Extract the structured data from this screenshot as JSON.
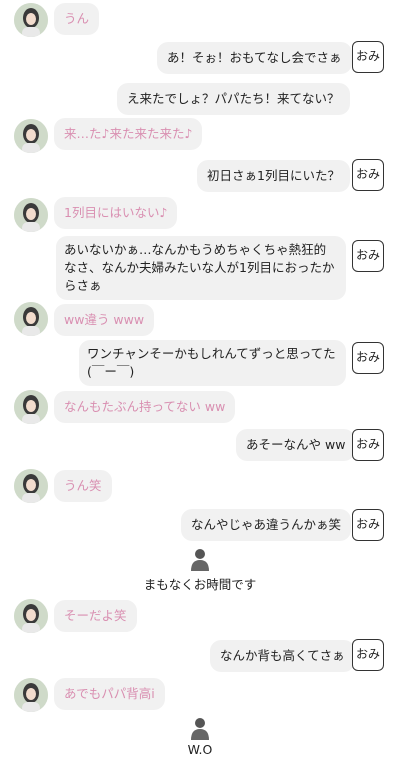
{
  "colors": {
    "incoming_text": "#d98fb1",
    "bubble_bg": "#f1f1f1",
    "outgoing_text": "#222222"
  },
  "badge_label": "おみ",
  "messages": [
    {
      "text": "うん"
    },
    {
      "text": "あ！そぉ！おもてなし会でさぁ"
    },
    {
      "text": "え来たでしょ？パパたち！来てない？"
    },
    {
      "text": "来…た♪来た来た来た♪"
    },
    {
      "text": "初日さぁ1列目にいた？"
    },
    {
      "text": "1列目にはいない♪"
    },
    {
      "text": "あいないかぁ…なんかもうめちゃくちゃ熱狂的なさ、なんか夫婦みたいな人が1列目におったからさぁ"
    },
    {
      "text": "ww違う www"
    },
    {
      "text": "ワンチャンそーかもしれんてずっと思ってた(￣ー￣)"
    },
    {
      "text": "なんもたぶん持ってない ww"
    },
    {
      "text": "あそーなんや ww"
    },
    {
      "text": "うん笑"
    },
    {
      "text": "なんやじゃあ違うんかぁ笑"
    },
    {
      "text": "まもなくお時間です"
    },
    {
      "text": "そーだよ笑"
    },
    {
      "text": "なんか背も高くてさぁ"
    },
    {
      "text": "あでもパパ背高i"
    },
    {
      "text": "W.O"
    }
  ]
}
